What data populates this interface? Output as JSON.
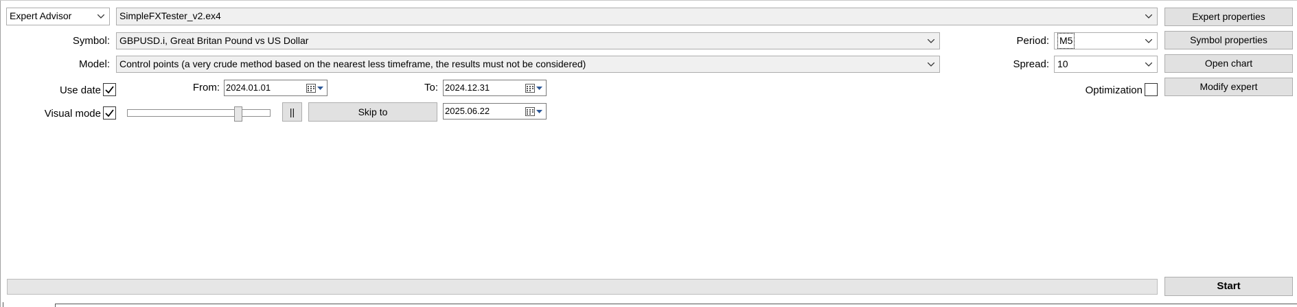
{
  "top": {
    "type_select": "Expert Advisor",
    "expert_file": "SimpleFXTester_v2.ex4"
  },
  "symbol": {
    "label": "Symbol:",
    "value": "GBPUSD.i, Great Britan Pound vs US Dollar"
  },
  "model": {
    "label": "Model:",
    "value": "Control points (a very crude method based on the nearest less timeframe, the results must not be considered)"
  },
  "period": {
    "label": "Period:",
    "value": "M5"
  },
  "spread": {
    "label": "Spread:",
    "value": "10"
  },
  "use_date": {
    "label": "Use date",
    "checked": true
  },
  "from": {
    "label": "From:",
    "value": "2024.01.01"
  },
  "to": {
    "label": "To:",
    "value": "2024.12.31"
  },
  "visual_mode": {
    "label": "Visual mode",
    "checked": true,
    "speed": 0.79
  },
  "pause_label": "||",
  "skip_to": {
    "label": "Skip to",
    "date": "2025.06.22"
  },
  "optimization": {
    "label": "Optimization",
    "checked": false
  },
  "buttons": {
    "expert_properties": "Expert properties",
    "symbol_properties": "Symbol properties",
    "open_chart": "Open chart",
    "modify_expert": "Modify expert",
    "start": "Start"
  },
  "progress": {
    "value": 0
  }
}
